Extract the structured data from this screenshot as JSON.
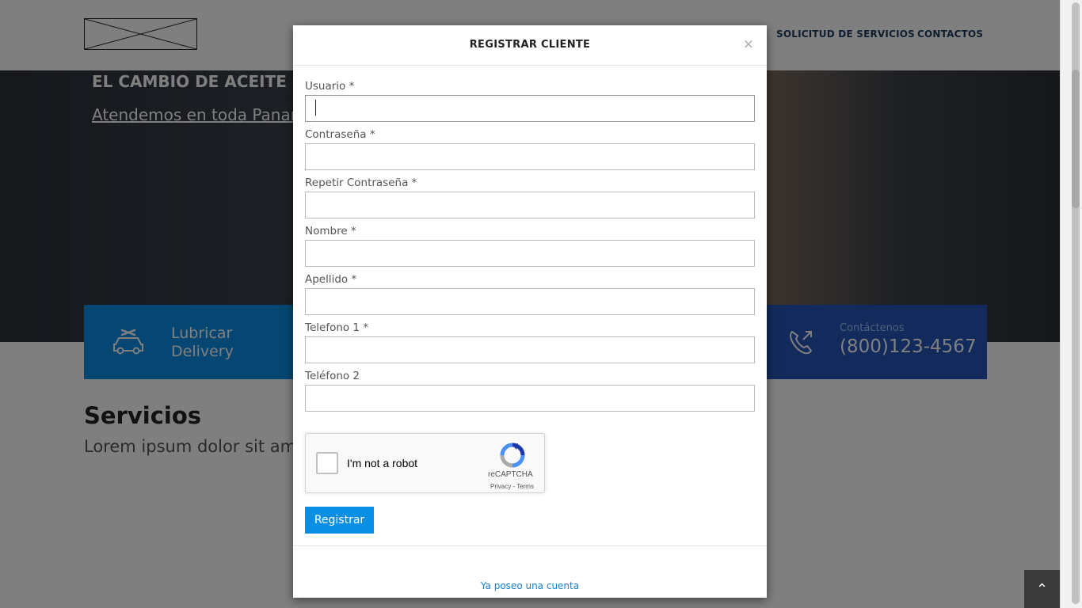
{
  "header": {
    "nav": [
      "SOLICITUD DE SERVICIOS",
      "CONTACTOS"
    ]
  },
  "hero": {
    "title": "EL CAMBIO DE ACEITE QU",
    "subtitle": "Atendemos en toda Panama"
  },
  "info_left": {
    "line1": "Lubricar",
    "line2": "Delivery"
  },
  "info_right": {
    "label": "Contáctenos",
    "phone": "(800)123-4567"
  },
  "services": {
    "title": "Servicios",
    "text": "Lorem ipsum dolor sit ame"
  },
  "modal": {
    "title": "REGISTRAR CLIENTE",
    "close": "×",
    "fields": [
      {
        "label": "Usuario *",
        "value": ""
      },
      {
        "label": "Contraseña *",
        "value": ""
      },
      {
        "label": "Repetir Contraseña *",
        "value": ""
      },
      {
        "label": "Nombre *",
        "value": ""
      },
      {
        "label": "Apellido *",
        "value": ""
      },
      {
        "label": "Telefono 1 *",
        "value": ""
      },
      {
        "label": "Teléfono 2",
        "value": ""
      }
    ],
    "captcha": {
      "label": "I'm not a robot",
      "brand": "reCAPTCHA",
      "links": "Privacy - Terms"
    },
    "submit": "Registrar",
    "login_link": "Ya poseo una cuenta"
  },
  "scroll_top_icon": "chevron-up-icon",
  "colors": {
    "primary": "#0b8fe5",
    "secondary": "#2657b8",
    "link": "#1a7fc9"
  }
}
